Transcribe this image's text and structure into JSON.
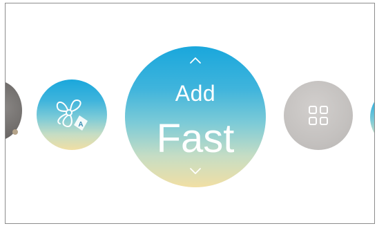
{
  "main_control": {
    "label_top": "Add",
    "label_value": "Fast"
  },
  "icons": {
    "fan_mode": "fan-auto-icon",
    "menu": "grid-menu-icon",
    "increase": "chevron-up-icon",
    "decrease": "chevron-down-icon"
  },
  "colors": {
    "gradient_top": "#1aa7dc",
    "gradient_bottom": "#f1dfa4",
    "menu_button": "#c4c1bf",
    "left_partial_button": "#6f6c6a"
  }
}
